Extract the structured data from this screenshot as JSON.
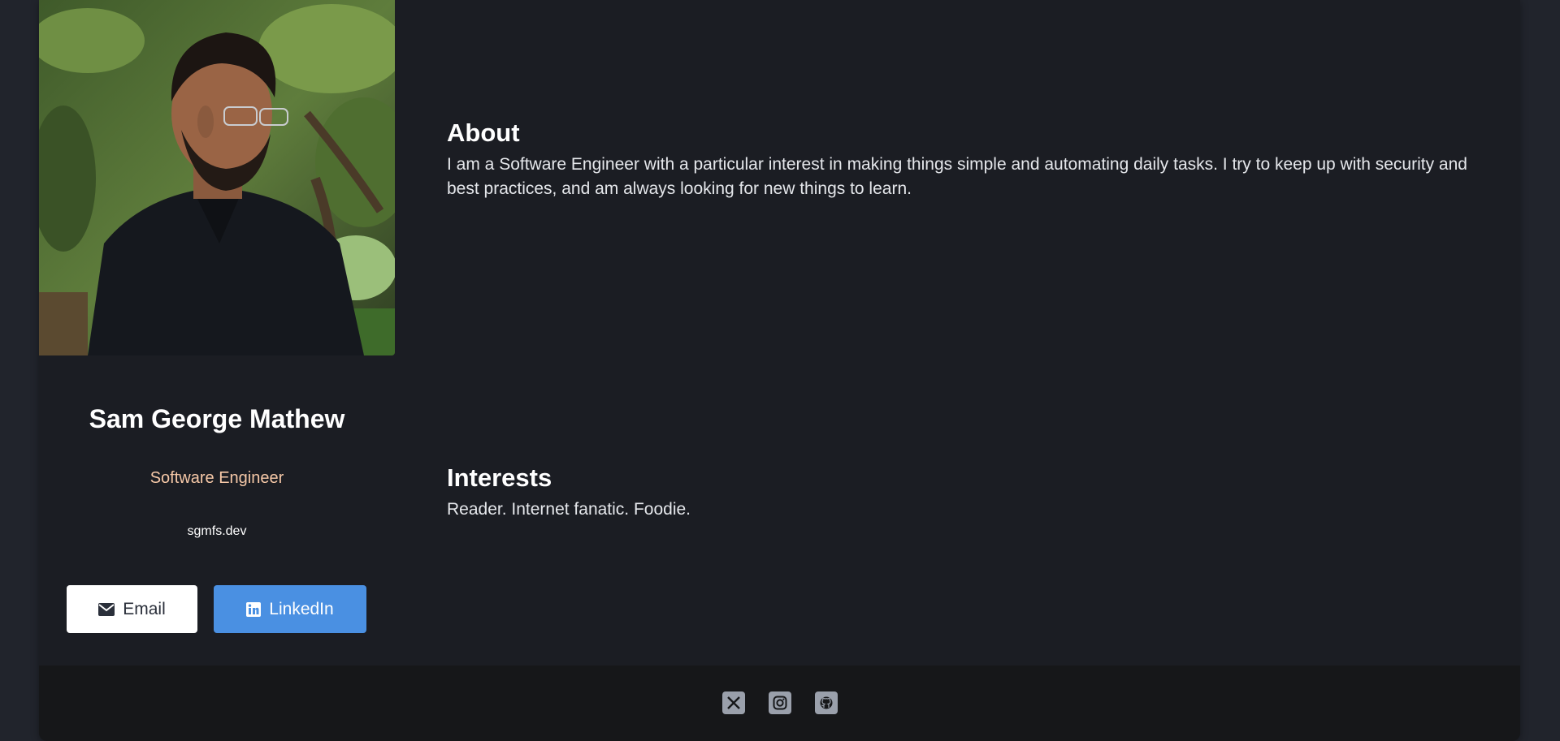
{
  "profile": {
    "name": "Sam George Mathew",
    "role": "Software Engineer",
    "website": "sgmfs.dev",
    "photo_alt": "Profile photo"
  },
  "buttons": {
    "email_label": "Email",
    "linkedin_label": "LinkedIn"
  },
  "about": {
    "title": "About",
    "text": "I am a Software Engineer with a particular interest in making things simple and automating daily tasks. I try to keep up with security and best practices, and am always looking for new things to learn."
  },
  "interests": {
    "title": "Interests",
    "text": "Reader. Internet fanatic. Foodie."
  },
  "social": [
    {
      "name": "X",
      "icon": "x-icon"
    },
    {
      "name": "Instagram",
      "icon": "instagram-icon"
    },
    {
      "name": "GitHub",
      "icon": "github-icon"
    }
  ],
  "colors": {
    "page_bg": "#21242c",
    "card_bg": "#1b1d23",
    "footer_bg": "#161719",
    "role_text": "#f6c8a7",
    "linkedin_button": "#4a90e2",
    "email_button": "#ffffff"
  }
}
